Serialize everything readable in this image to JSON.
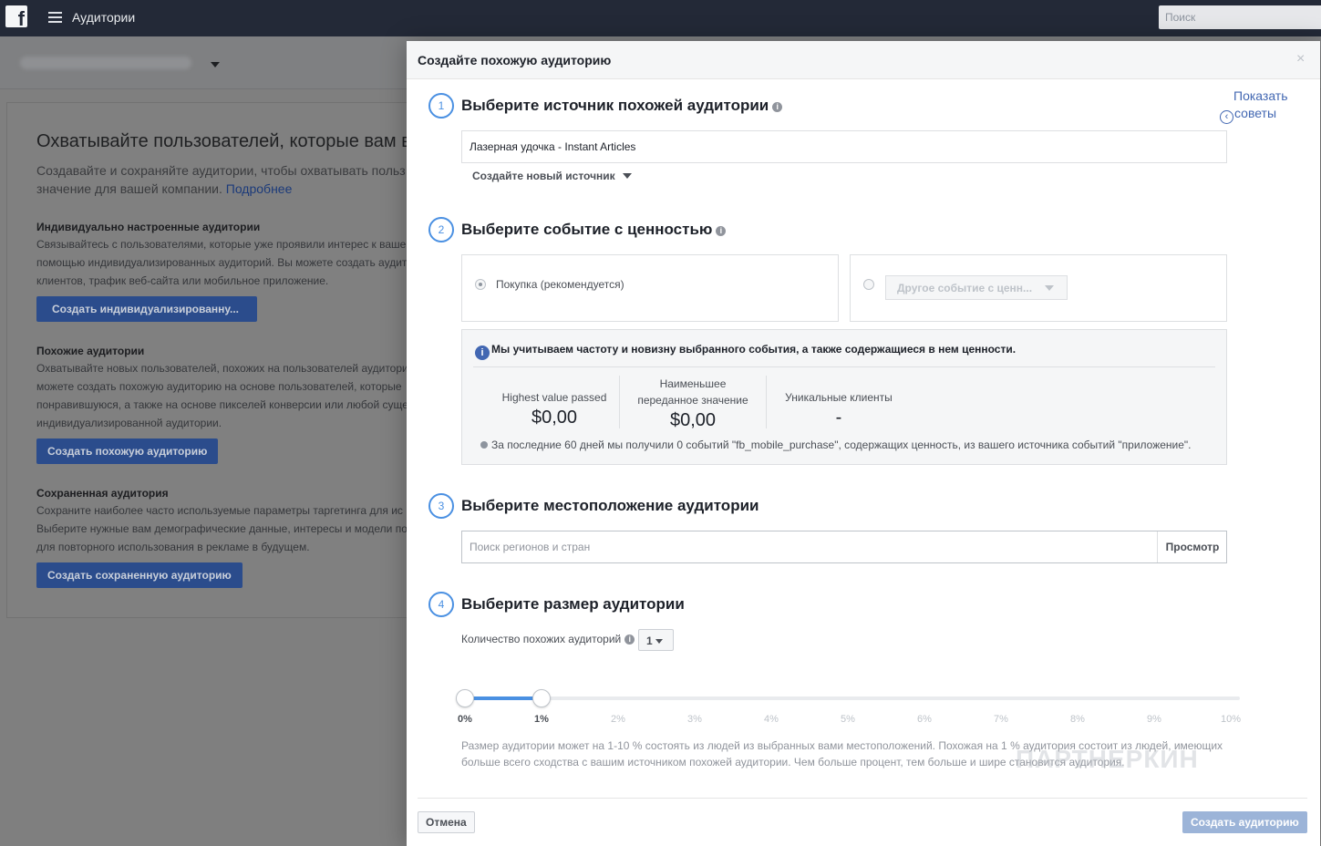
{
  "topbar": {
    "logo": "f",
    "title": "Аудитории",
    "search_placeholder": "Поиск"
  },
  "background": {
    "heading": "Охватывайте пользователей, которые вам в",
    "intro_line1": "Создавайте и сохраняйте аудитории, чтобы охватывать польз",
    "intro_line2": "значение для вашей компании.",
    "learn_more": "Подробнее",
    "custom": {
      "title": "Индивидуально настроенные аудитории",
      "lines": [
        "Связывайтесь с пользователями, которые уже проявили интерес к ваше",
        "помощью индивидуализированных аудиторий. Вы можете создать аудит",
        "клиентов, трафик веб-сайта или мобильное приложение."
      ],
      "button": "Создать индивидуализированну..."
    },
    "lookalike": {
      "title": "Похожие аудитории",
      "lines": [
        "Охватывайте новых пользователей, похожих на пользователей аудитори",
        "можете создать похожую аудиторию на основе пользователей, которые",
        "понравившуюся, а также на основе пикселей конверсии или любой суще",
        "индивидуализированной аудитории."
      ],
      "button": "Создать похожую аудиторию"
    },
    "saved": {
      "title": "Сохраненная аудитория",
      "lines": [
        "Сохраните наиболее часто используемые параметры таргетинга для ис",
        "Выберите нужные вам демографические данные, интересы и модели по",
        "для повторного использования в рекламе в будущем."
      ],
      "button": "Создать сохраненную аудиторию"
    }
  },
  "modal": {
    "title": "Создайте похожую аудиторию",
    "close": "×",
    "tips_line1": "Показать",
    "tips_line2": "советы",
    "tips_chevron": "‹",
    "step1": {
      "number": "1",
      "title": "Выберите источник похожей аудитории",
      "source_value": "Лазерная удочка - Instant Articles",
      "create_source": "Создайте новый источник"
    },
    "step2": {
      "number": "2",
      "title": "Выберите событие с ценностью",
      "option_purchase": "Покупка (рекомендуется)",
      "option_other": "Другое событие с ценн...",
      "info_text": "Мы учитываем частоту и новизну выбранного события, а также содержащиеся в нем ценности.",
      "info_icon": "i",
      "stats": [
        {
          "label": "Highest value passed",
          "value": "$0,00"
        },
        {
          "label": "Наименьшее переданное значение",
          "value": "$0,00"
        },
        {
          "label": "Уникальные клиенты",
          "value": "-"
        }
      ],
      "note": "За последние 60 дней мы получили 0 событий \"fb_mobile_purchase\", содержащих ценность, из вашего источника событий \"приложение\"."
    },
    "step3": {
      "number": "3",
      "title": "Выберите местоположение аудитории",
      "location_placeholder": "Поиск регионов и стран",
      "browse": "Просмотр"
    },
    "step4": {
      "number": "4",
      "title": "Выберите размер аудитории",
      "count_label": "Количество похожих аудиторий",
      "count_value": "1",
      "slider": {
        "min_percent": 0,
        "max_percent": 10,
        "selected_from": 0,
        "selected_to": 1,
        "ticks": [
          "0%",
          "1%",
          "2%",
          "3%",
          "4%",
          "5%",
          "6%",
          "7%",
          "8%",
          "9%",
          "10%"
        ]
      },
      "description": "Размер аудитории может на 1-10 % состоять из людей из выбранных вами местоположений. Похожая на 1 % аудитория состоит из людей, имеющих больше всего сходства с вашим источником похожей аудитории. Чем больше процент, тем больше и шире становится аудитория."
    },
    "cancel": "Отмена",
    "create": "Создать аудиторию"
  },
  "watermark": "ПАРТНЕРКИН",
  "colors": {
    "topbar": "#232937",
    "accent": "#4a90e2",
    "primary_button": "#4267b2",
    "disabled_button": "#9cb4d8"
  }
}
